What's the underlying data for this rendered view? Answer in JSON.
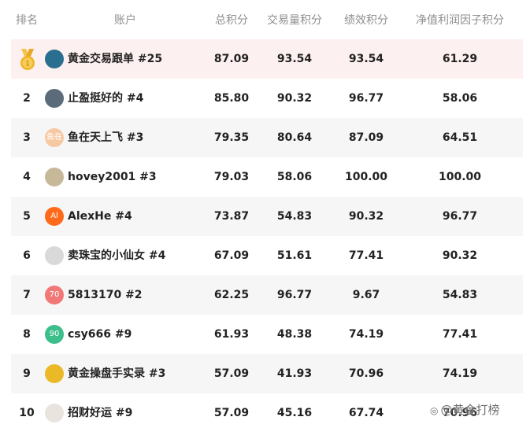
{
  "headers": {
    "rank": "排名",
    "account": "账户",
    "total": "总积分",
    "volume": "交易量积分",
    "performance": "绩效积分",
    "net_value": "净值利润因子积分"
  },
  "rows": [
    {
      "rank": "1",
      "name": "黄金交易跟单 #25",
      "total": "87.09",
      "volume": "93.54",
      "performance": "93.54",
      "net_value": "61.29",
      "avatar_text": "",
      "avatar_color": "#2a6f8f",
      "medal": "gold-medal-icon"
    },
    {
      "rank": "2",
      "name": "止盈挺好的 #4",
      "total": "85.80",
      "volume": "90.32",
      "performance": "96.77",
      "net_value": "58.06",
      "avatar_text": "",
      "avatar_color": "#5b6b7a"
    },
    {
      "rank": "3",
      "name": "鱼在天上飞 #3",
      "total": "79.35",
      "volume": "80.64",
      "performance": "87.09",
      "net_value": "64.51",
      "avatar_text": "鱼在",
      "avatar_color": "#f6c9a3"
    },
    {
      "rank": "4",
      "name": "hovey2001 #3",
      "total": "79.03",
      "volume": "58.06",
      "performance": "100.00",
      "net_value": "100.00",
      "avatar_text": "",
      "avatar_color": "#c8b89a"
    },
    {
      "rank": "5",
      "name": "AlexHe #4",
      "total": "73.87",
      "volume": "54.83",
      "performance": "90.32",
      "net_value": "96.77",
      "avatar_text": "Al",
      "avatar_color": "#ff6a1a"
    },
    {
      "rank": "6",
      "name": "卖珠宝的小仙女 #4",
      "total": "67.09",
      "volume": "51.61",
      "performance": "77.41",
      "net_value": "90.32",
      "avatar_text": "",
      "avatar_color": "#d9d9d9"
    },
    {
      "rank": "7",
      "name": "5813170 #2",
      "total": "62.25",
      "volume": "96.77",
      "performance": "9.67",
      "net_value": "54.83",
      "avatar_text": "70",
      "avatar_color": "#f27777"
    },
    {
      "rank": "8",
      "name": "csy666 #9",
      "total": "61.93",
      "volume": "48.38",
      "performance": "74.19",
      "net_value": "77.41",
      "avatar_text": "90",
      "avatar_color": "#3cbf8a"
    },
    {
      "rank": "9",
      "name": "黄金操盘手实录 #3",
      "total": "57.09",
      "volume": "41.93",
      "performance": "70.96",
      "net_value": "74.19",
      "avatar_text": "",
      "avatar_color": "#e9b928"
    },
    {
      "rank": "10",
      "name": "招财好运 #9",
      "total": "57.09",
      "volume": "45.16",
      "performance": "67.74",
      "net_value": "70.96",
      "avatar_text": "",
      "avatar_color": "#e9e4de"
    }
  ],
  "watermark": "@黄金打榜",
  "colors": {
    "top_row_bg": "#fdf0f0",
    "alt_row_bg": "#f6f6f6",
    "header_text": "#8f8f8f",
    "medal_gold": "#f0b429"
  }
}
